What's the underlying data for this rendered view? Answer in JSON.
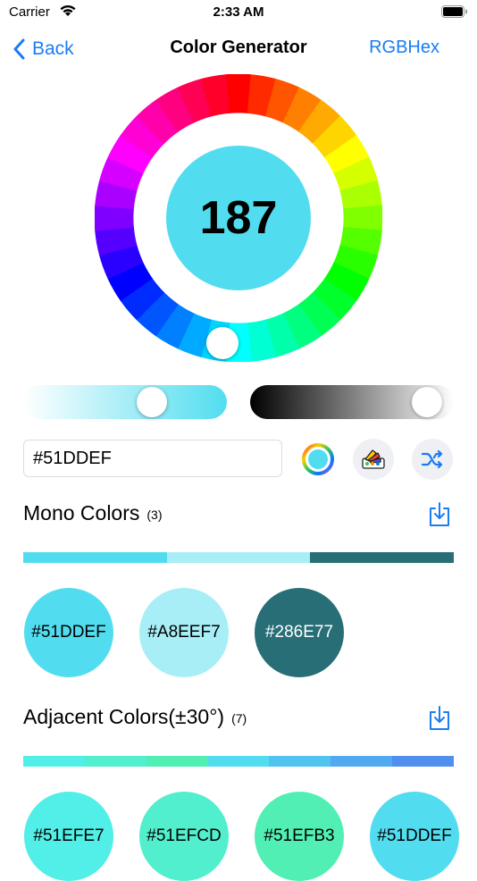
{
  "status": {
    "carrier": "Carrier",
    "time": "2:33 AM"
  },
  "nav": {
    "back_label": "Back",
    "title": "Color Generator",
    "right_label": "RGBHex"
  },
  "wheel": {
    "hue_value": "187",
    "center_color": "#51DDEF"
  },
  "hex_input": {
    "value": "#51DDEF"
  },
  "mono": {
    "title": "Mono Colors",
    "count": "(3)",
    "bar": [
      "#51DDEF",
      "#A8EEF7",
      "#286E77"
    ],
    "swatches": [
      {
        "label": "#51DDEF",
        "color": "#51DDEF",
        "text_color": "#000000"
      },
      {
        "label": "#A8EEF7",
        "color": "#A8EEF7",
        "text_color": "#000000"
      },
      {
        "label": "#286E77",
        "color": "#286E77",
        "text_color": "#FFFFFF"
      }
    ]
  },
  "adjacent": {
    "title": "Adjacent Colors(±30°)",
    "count": "(7)",
    "bar": [
      "#51EFE7",
      "#51EFCD",
      "#51EFB3",
      "#51DDEF",
      "#51C3EF",
      "#51A9EF",
      "#518FEF"
    ],
    "swatches": [
      {
        "label": "#51EFE7",
        "color": "#51EFE7",
        "text_color": "#000000"
      },
      {
        "label": "#51EFCD",
        "color": "#51EFCD",
        "text_color": "#000000"
      },
      {
        "label": "#51EFB3",
        "color": "#51EFB3",
        "text_color": "#000000"
      },
      {
        "label": "#51DDEF",
        "color": "#51DDEF",
        "text_color": "#000000"
      }
    ]
  },
  "colors": {
    "accent": "#1A7CF5"
  }
}
